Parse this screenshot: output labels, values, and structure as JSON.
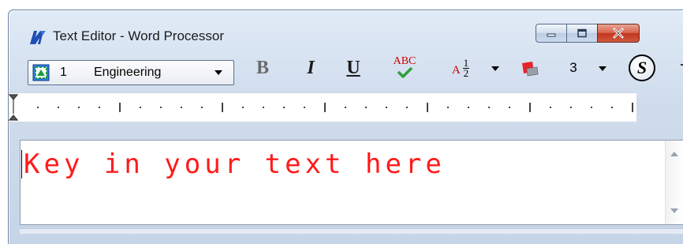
{
  "window": {
    "title": "Text Editor - Word Processor",
    "icon": "microstation-logo-icon"
  },
  "caption_buttons": [
    "minimize-icon",
    "maximize-icon",
    "close-icon"
  ],
  "toolbar": {
    "level_number": "1",
    "level_name": "Engineering",
    "bold_label": "B",
    "italic_label": "I",
    "underline_label": "U",
    "spell_label": "ABC",
    "fraction_prefix": "A",
    "fraction_num": "1",
    "fraction_den": "2",
    "weight_value": "3",
    "stack_label": "S"
  },
  "colors": {
    "text": "#ff1a1a",
    "titlebar": "#cfdcec",
    "close_button": "#c2351d"
  },
  "editor": {
    "text": "Key in your text here"
  }
}
